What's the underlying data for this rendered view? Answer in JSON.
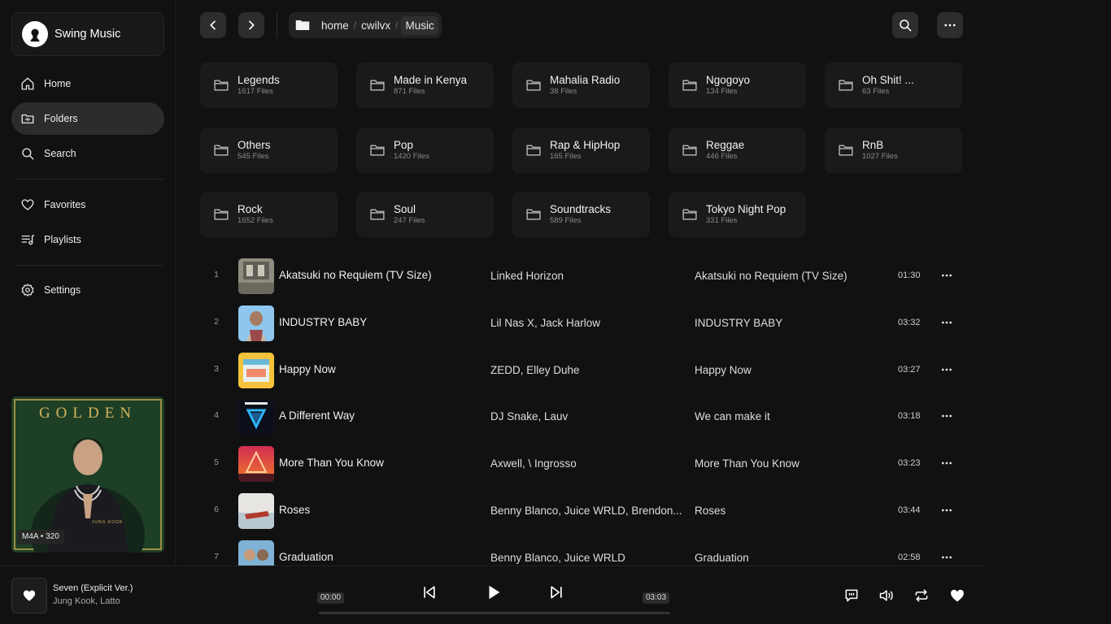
{
  "brand": {
    "title": "Swing Music"
  },
  "sidebar": {
    "items": [
      {
        "label": "Home",
        "icon": "home-icon"
      },
      {
        "label": "Folders",
        "icon": "folder-icon",
        "active": true
      },
      {
        "label": "Search",
        "icon": "search-icon"
      },
      {
        "label": "Favorites",
        "icon": "heart-icon"
      },
      {
        "label": "Playlists",
        "icon": "playlist-icon"
      },
      {
        "label": "Settings",
        "icon": "gear-icon"
      }
    ]
  },
  "album_card": {
    "cover_text": "GOLDEN",
    "artist_text": "JUNG KOOK",
    "format_badge": "M4A • 320"
  },
  "breadcrumb": {
    "items": [
      "home",
      "cwilvx"
    ],
    "current": "Music"
  },
  "folders": [
    {
      "name": "Legends",
      "count": "1617 Files"
    },
    {
      "name": "Made in Kenya",
      "count": "871 Files"
    },
    {
      "name": "Mahalia Radio",
      "count": "38 Files"
    },
    {
      "name": "Ngogoyo",
      "count": "134 Files"
    },
    {
      "name": "Oh Shit! ...",
      "count": "63 Files"
    },
    {
      "name": "Others",
      "count": "545 Files"
    },
    {
      "name": "Pop",
      "count": "1420 Files"
    },
    {
      "name": "Rap & HipHop",
      "count": "165 Files"
    },
    {
      "name": "Reggae",
      "count": "446 Files"
    },
    {
      "name": "RnB",
      "count": "1027 Files"
    },
    {
      "name": "Rock",
      "count": "1652 Files"
    },
    {
      "name": "Soul",
      "count": "247 Files"
    },
    {
      "name": "Soundtracks",
      "count": "589 Files"
    },
    {
      "name": "Tokyo Night Pop",
      "count": "331 Files"
    }
  ],
  "tracks": [
    {
      "index": "1",
      "title": "Akatsuki no Requiem (TV Size)",
      "artist": "Linked Horizon",
      "album": "Akatsuki no Requiem (TV Size)",
      "duration": "01:30"
    },
    {
      "index": "2",
      "title": "INDUSTRY BABY",
      "artist": "Lil Nas X, Jack Harlow",
      "album": "INDUSTRY BABY",
      "duration": "03:32"
    },
    {
      "index": "3",
      "title": "Happy Now",
      "artist": "ZEDD, Elley Duhe",
      "album": "Happy Now",
      "duration": "03:27"
    },
    {
      "index": "4",
      "title": "A Different Way",
      "artist": "DJ Snake, Lauv",
      "album": "We can make it",
      "duration": "03:18"
    },
    {
      "index": "5",
      "title": "More Than You Know",
      "artist": "Axwell, \\ Ingrosso",
      "album": "More Than You Know",
      "duration": "03:23"
    },
    {
      "index": "6",
      "title": "Roses",
      "artist": "Benny Blanco, Juice WRLD, Brendon...",
      "album": "Roses",
      "duration": "03:44"
    },
    {
      "index": "7",
      "title": "Graduation",
      "artist": "Benny Blanco, Juice WRLD",
      "album": "Graduation",
      "duration": "02:58"
    }
  ],
  "player": {
    "title": "Seven (Explicit Ver.)",
    "artist": "Jung Kook, Latto",
    "elapsed": "00:00",
    "total": "03:03",
    "progress": 0
  },
  "colors": {
    "background": "#111111",
    "surface": "#1a1a1a",
    "active": "#2c2c2c",
    "accent_green": "#1e4a2a",
    "gold": "#d4b35a"
  }
}
